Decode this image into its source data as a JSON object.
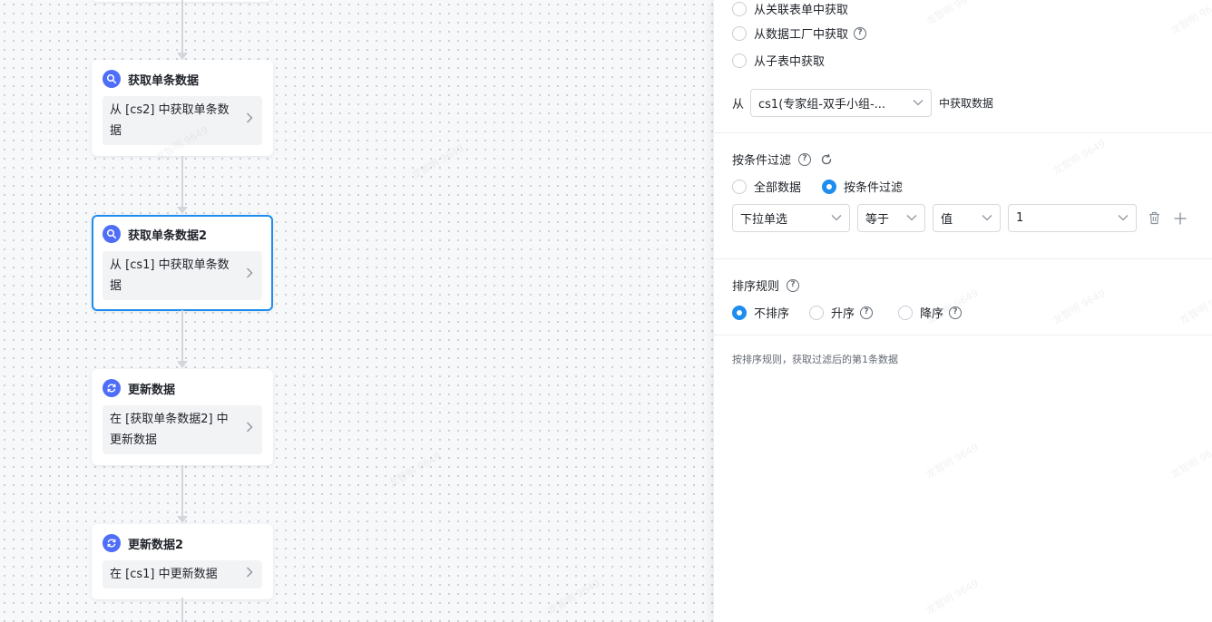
{
  "canvas": {
    "nodes": [
      {
        "title": "获取单条数据",
        "body": "从 [cs2] 中获取单条数据",
        "icon": "search-icon"
      },
      {
        "title": "获取单条数据2",
        "body": "从 [cs1] 中获取单条数据",
        "icon": "search-icon",
        "selected": true
      },
      {
        "title": "更新数据",
        "body": "在 [获取单条数据2] 中更新数据",
        "icon": "refresh-icon"
      },
      {
        "title": "更新数据2",
        "body": "在 [cs1] 中更新数据",
        "icon": "refresh-icon"
      }
    ],
    "watermark": "龙智明 9649"
  },
  "panel": {
    "source_options": [
      {
        "label": "从关联表单中获取",
        "checked": false,
        "help": false
      },
      {
        "label": "从数据工厂中获取",
        "checked": false,
        "help": true
      },
      {
        "label": "从子表中获取",
        "checked": false,
        "help": false
      }
    ],
    "from_prefix": "从",
    "from_select": "cs1(专家组-双手小组-...",
    "from_suffix": "中获取数据",
    "filter": {
      "title": "按条件过滤",
      "options": [
        {
          "label": "全部数据",
          "checked": false
        },
        {
          "label": "按条件过滤",
          "checked": true
        }
      ],
      "field": "下拉单选",
      "operator": "等于",
      "value_type": "值",
      "value": "1"
    },
    "sort": {
      "title": "排序规则",
      "options": [
        {
          "label": "不排序",
          "checked": true,
          "help": false
        },
        {
          "label": "升序",
          "checked": false,
          "help": true
        },
        {
          "label": "降序",
          "checked": false,
          "help": true
        }
      ]
    },
    "hint": "按排序规则，获取过滤后的第1条数据"
  },
  "colors": {
    "accent": "#1e8df0",
    "node_icon": "#4f6ef7"
  }
}
